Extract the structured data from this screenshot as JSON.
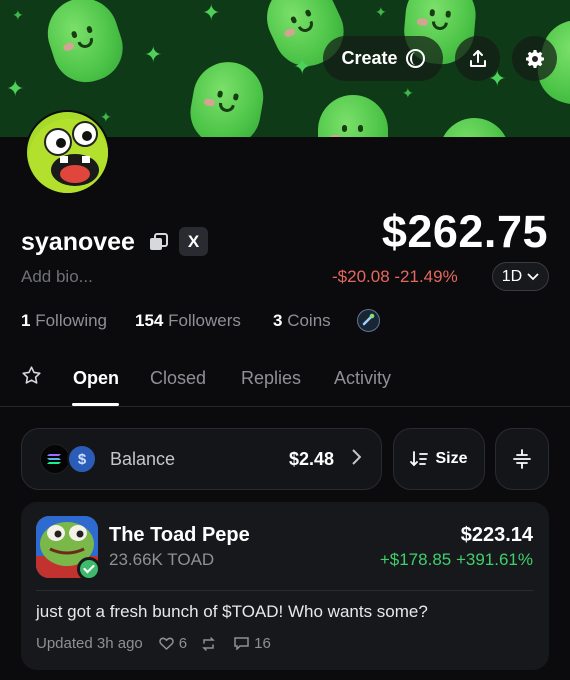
{
  "header": {
    "create_label": "Create"
  },
  "profile": {
    "username": "syanovee",
    "x_label": "X",
    "bio_placeholder": "Add bio...",
    "portfolio_value": "$262.75",
    "change_text": "-$20.08 -21.49%",
    "period": "1D",
    "following_count": "1",
    "following_label": "Following",
    "followers_count": "154",
    "followers_label": "Followers",
    "coins_count": "3",
    "coins_label": "Coins"
  },
  "tabs": [
    {
      "label": "Open",
      "active": true
    },
    {
      "label": "Closed",
      "active": false
    },
    {
      "label": "Replies",
      "active": false
    },
    {
      "label": "Activity",
      "active": false
    }
  ],
  "balance": {
    "label": "Balance",
    "value": "$2.48",
    "usd_symbol": "$",
    "size_label": "Size"
  },
  "holdings": [
    {
      "name": "The Toad Pepe",
      "amount": "23.66K TOAD",
      "value": "$223.14",
      "change": "+$178.85 +391.61%",
      "description": "just got a fresh bunch of $TOAD! Who wants some?",
      "updated": "Updated 3h ago",
      "likes": "6",
      "comments": "16"
    }
  ],
  "colors": {
    "background": "#0b0b0e",
    "negative": "#e5675f",
    "positive": "#3fcf6b",
    "banner_green": "#4cc447"
  },
  "icons": [
    "copy-icon",
    "x-logo-icon",
    "chevron-down-icon",
    "coin-icon",
    "star-icon",
    "share-icon",
    "gear-icon",
    "sort-icon",
    "filter-icon",
    "heart-icon",
    "repost-icon",
    "comment-icon"
  ]
}
